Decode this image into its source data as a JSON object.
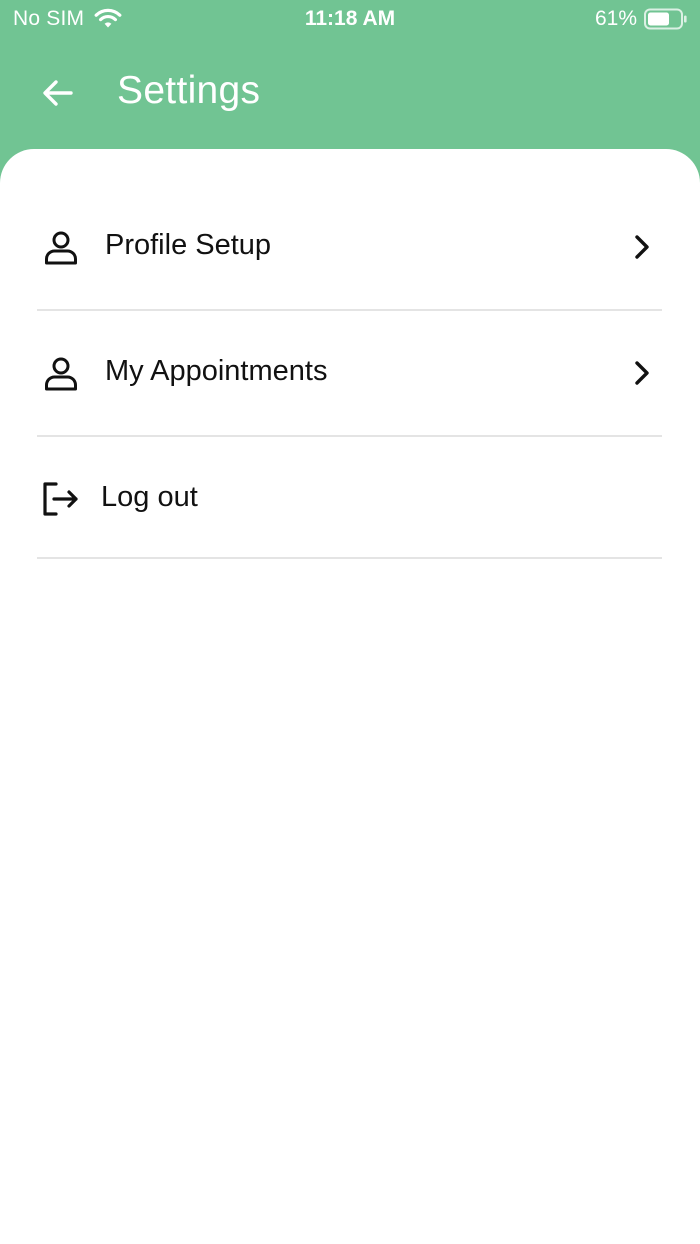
{
  "status_bar": {
    "carrier": "No SIM",
    "time": "11:18 AM",
    "battery": "61%",
    "icons": [
      "wifi-icon",
      "battery-icon"
    ]
  },
  "header": {
    "title": "Settings",
    "back_icon": "arrow-left-icon"
  },
  "menu": {
    "items": [
      {
        "label": "Profile Setup",
        "icon": "person-icon",
        "trailing_icon": "chevron-right-icon"
      },
      {
        "label": "My Appointments",
        "icon": "person-icon",
        "trailing_icon": "chevron-right-icon"
      },
      {
        "label": "Log out",
        "icon": "logout-icon"
      }
    ]
  },
  "colors": {
    "header_background": "#71c493",
    "sheet_background": "#ffffff",
    "divider": "#e4e4e4",
    "text": "#111111"
  }
}
